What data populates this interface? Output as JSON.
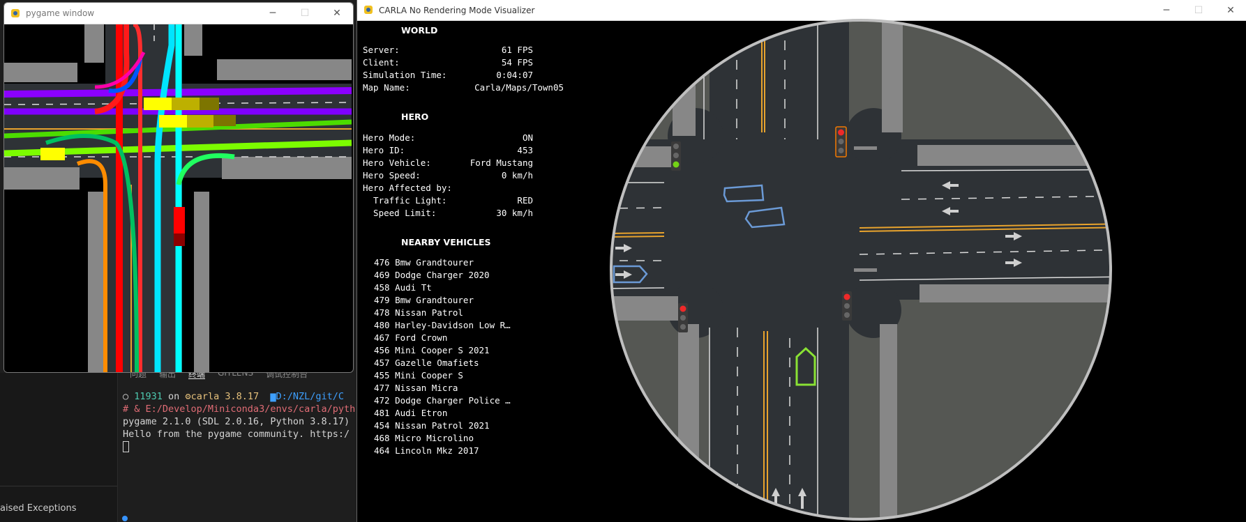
{
  "ide": {
    "panel_tabs": [
      "问题",
      "输出",
      "终端",
      "GITLENS",
      "调试控制台"
    ],
    "active_tab": "终端",
    "sidebar_label": "aised Exceptions",
    "terminal": {
      "line1_pid": "11931",
      "line1_on": " on ",
      "line1_env": "carla 3.8.17",
      "line1_path": "D:/NZL/git/C",
      "line2": "# & E:/Develop/Miniconda3/envs/carla/pyth",
      "line3": "pygame 2.1.0 (SDL 2.0.16, Python 3.8.17)",
      "line4": "Hello from the pygame community. https:/"
    }
  },
  "pygame_window": {
    "title": "pygame window"
  },
  "carla_window": {
    "title": "CARLA No Rendering Mode Visualizer"
  },
  "window_controls": {
    "minimize": "─",
    "maximize": "☐",
    "close": "✕"
  },
  "hud": {
    "world": {
      "title": "WORLD",
      "rows": [
        {
          "label": "Server:",
          "value": "61 FPS"
        },
        {
          "label": "Client:",
          "value": "54 FPS"
        },
        {
          "label": "Simulation Time:",
          "value": "0:04:07"
        },
        {
          "label": "Map Name:",
          "value": "Carla/Maps/Town05"
        }
      ]
    },
    "hero": {
      "title": "HERO",
      "rows": [
        {
          "label": "Hero Mode:",
          "value": "ON"
        },
        {
          "label": "Hero ID:",
          "value": "453"
        },
        {
          "label": "Hero Vehicle:",
          "value": "Ford Mustang"
        },
        {
          "label": "Hero Speed:",
          "value": "0 km/h"
        },
        {
          "label": "Hero Affected by:",
          "value": ""
        },
        {
          "label": "  Traffic Light:",
          "value": "RED"
        },
        {
          "label": "  Speed Limit:",
          "value": "30 km/h"
        }
      ]
    },
    "nearby": {
      "title": "NEARBY VEHICLES",
      "vehicles": [
        "476 Bmw Grandtourer",
        "469 Dodge Charger 2020",
        "458 Audi Tt",
        "479 Bmw Grandtourer",
        "478 Nissan Patrol",
        "480 Harley-Davidson Low R…",
        "467 Ford Crown",
        "456 Mini Cooper S 2021",
        "457 Gazelle Omafiets",
        "455 Mini Cooper S",
        "477 Nissan Micra",
        "472 Dodge Charger Police …",
        "481 Audi Etron",
        "454 Nissan Patrol 2021",
        "468 Micro Microlino",
        "464 Lincoln Mkz 2017"
      ]
    }
  },
  "colors": {
    "road": "#2e3236",
    "sidewalk": "#878787",
    "lane_yellow": "#e8a32d",
    "lane_white": "#dcdcdc",
    "vehicle_blue": "#6b9ad6",
    "hero_green": "#8ae234",
    "light_red": "#ef2929",
    "light_green": "#73d216",
    "map_background": "#555753",
    "map_border": "#bfbfbf"
  },
  "icons": [
    "pygame-icon",
    "minimize-icon",
    "maximize-icon",
    "close-icon",
    "folder-icon",
    "python-icon",
    "arrow-icon",
    "traffic-light-icon"
  ]
}
